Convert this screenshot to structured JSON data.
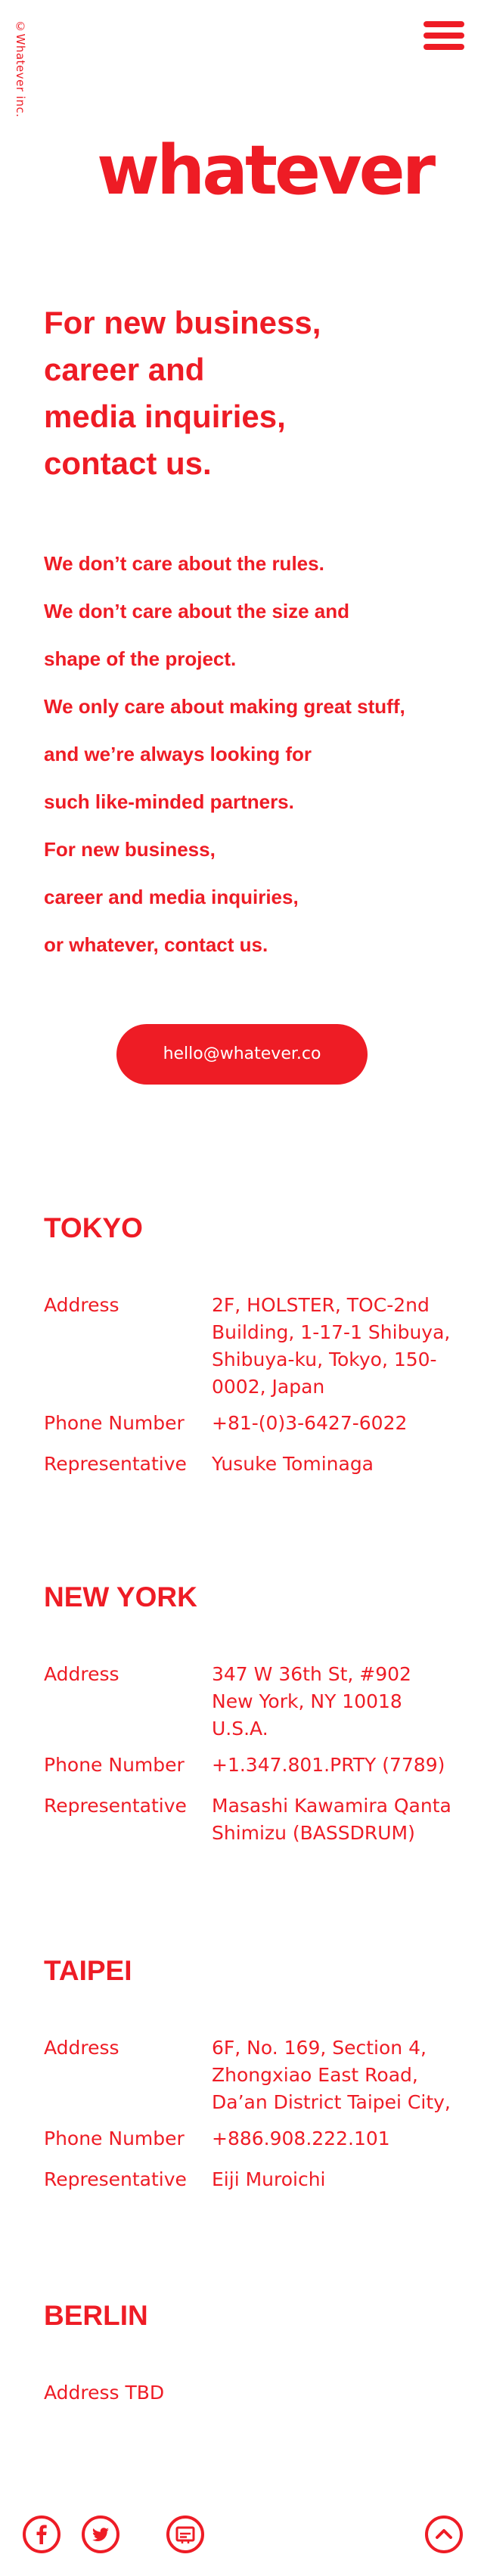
{
  "copyright": "©Whatever inc.",
  "logo": "whatever",
  "headline": [
    "For new business,",
    "career and",
    "media inquiries,",
    "contact us."
  ],
  "body_lines": [
    "We don’t care about the rules.",
    "We don’t care about the size and",
    "shape of the project.",
    "We only care about making great stuff,",
    "and we’re always looking for",
    "such like-minded partners.",
    "For new business,",
    "career and media inquiries,",
    "or whatever, contact us."
  ],
  "email": "hello@whatever.co",
  "offices": [
    {
      "city": "TOKYO",
      "address_label": "Address",
      "address": "2F, HOLSTER, TOC-2nd Building, 1-17-1 Shibuya, Shibuya-ku, Tokyo, 150-0002, Japan",
      "phone_label": "Phone Number",
      "phone": "+81-(0)3-6427-6022",
      "rep_label": "Representative",
      "rep": "Yusuke Tominaga"
    },
    {
      "city": "NEW YORK",
      "address_label": "Address",
      "address": "347 W 36th St, #902 New York, NY 10018 U.S.A.",
      "phone_label": "Phone Number",
      "phone": "+1.347.801.PRTY (7789)",
      "rep_label": "Representative",
      "rep": "Masashi Kawamira Qanta Shimizu (BASSDRUM)"
    },
    {
      "city": "TAIPEI",
      "address_label": "Address",
      "address": "6F, No. 169, Section 4, Zhongxiao East Road, Da’an District Taipei City,",
      "phone_label": "Phone Number",
      "phone": "+886.908.222.101",
      "rep_label": "Representative",
      "rep": "Eiji Muroichi"
    },
    {
      "city": "BERLIN",
      "address_tbd": "Address TBD"
    }
  ],
  "icons": {
    "menu": "hamburger-menu-icon",
    "facebook": "facebook-icon",
    "twitter": "twitter-icon",
    "note": "note-icon",
    "top": "chevron-up-icon"
  },
  "colors": {
    "brand_red": "#ee1c25",
    "background": "#ffffff"
  }
}
